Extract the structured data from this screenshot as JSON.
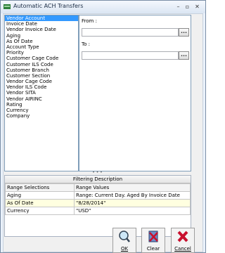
{
  "window": {
    "title": "Automatic ACH Transfers"
  },
  "list": {
    "items": [
      "Vendor Account",
      "Invoice Date",
      "Vendor Invoice Date",
      "Aging",
      "As Of Date",
      "Account Type",
      "Priority",
      "Customer Cage Code",
      "Customer ILS Code",
      "Customer Branch",
      "Customer Section",
      "Vendor Cage Code",
      "Vendor ILS Code",
      "Vendor SITA",
      "Vendor AIRINC",
      "Rating",
      "Currency",
      "Company"
    ],
    "selected": "Vendor Account"
  },
  "range": {
    "from_label": "From :",
    "to_label": "To :",
    "from_value": "",
    "to_value": "",
    "ellipsis": "..."
  },
  "filter": {
    "header": "Filtering Description",
    "col1": "Range Selections",
    "col2": "Range Values",
    "rows": [
      {
        "sel": "Aging",
        "val": "Range: Current Day. Aged By Invoice Date"
      },
      {
        "sel": "As Of Date",
        "val": "\"8/28/2014\""
      },
      {
        "sel": "Currency",
        "val": "\"USD\""
      }
    ]
  },
  "buttons": {
    "ok": "OK",
    "clear": "Clear",
    "cancel": "Cancel"
  },
  "colors": {
    "selection": "#3399ff",
    "alt_row": "#ffffe0",
    "cancel_x": "#c8102e"
  }
}
